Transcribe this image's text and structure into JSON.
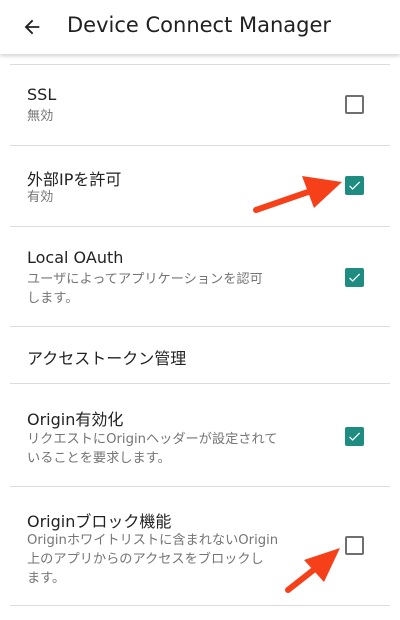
{
  "appbar": {
    "title": "Device Connect Manager",
    "back_icon": "arrow-left-icon"
  },
  "colors": {
    "accent": "#1e8c80",
    "annotation_arrow": "#f5401a"
  },
  "preferences": [
    {
      "title": "SSL",
      "summary": "無効",
      "checked": false
    },
    {
      "title": "外部IPを許可",
      "summary": "有効",
      "checked": true
    },
    {
      "title": "Local OAuth",
      "summary_line1": "ユーザによってアプリケーションを認可",
      "summary_line2": "します。",
      "checked": true
    },
    {
      "title": "アクセストークン管理"
    },
    {
      "title": "Origin有効化",
      "summary_line1": "リクエストにOriginヘッダーが設定されて",
      "summary_line2": "いることを要求します。",
      "checked": true
    },
    {
      "title": "Originブロック機能",
      "summary_line1": "Originホワイトリストに含まれないOrigin",
      "summary_line2": "上のアプリからのアクセスをブロックし",
      "summary_line3": "ます。",
      "checked": false
    }
  ]
}
